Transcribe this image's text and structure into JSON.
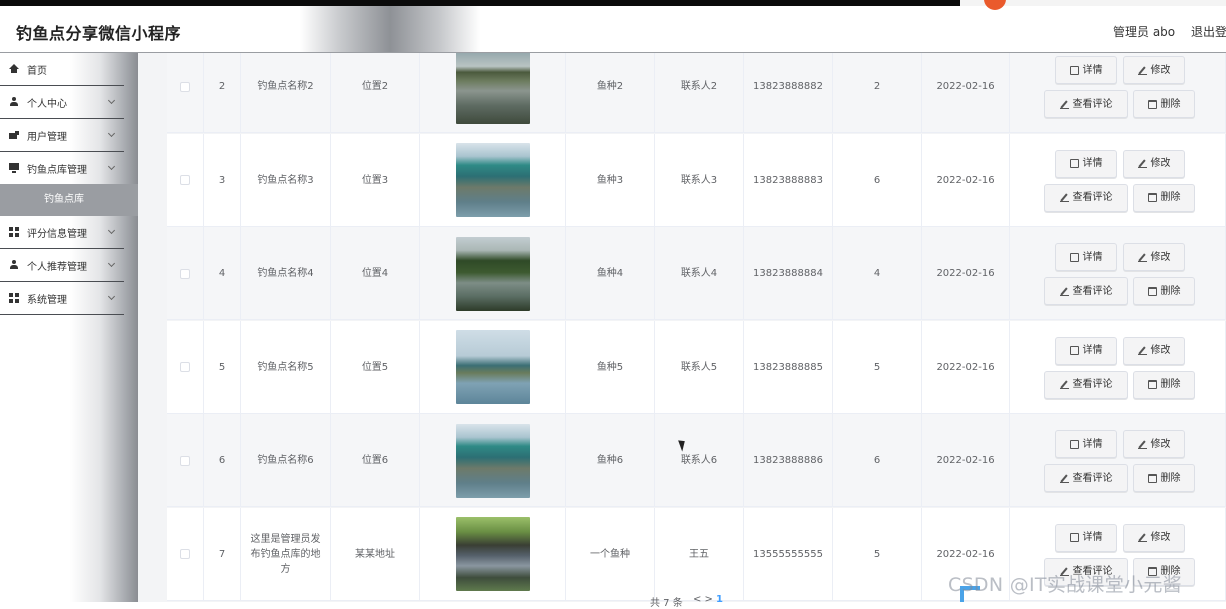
{
  "header": {
    "app_title": "钓鱼点分享微信小程序",
    "admin_label": "管理员 abo",
    "logout_label": "退出登"
  },
  "sidebar": {
    "items": [
      {
        "label": "首页",
        "icon": "home-icon"
      },
      {
        "label": "个人中心",
        "icon": "user-icon"
      },
      {
        "label": "用户管理",
        "icon": "users-icon"
      },
      {
        "label": "钓鱼点库管理",
        "icon": "monitor-icon"
      },
      {
        "label": "评分信息管理",
        "icon": "grid-icon"
      },
      {
        "label": "个人推荐管理",
        "icon": "user-icon"
      },
      {
        "label": "系统管理",
        "icon": "grid-icon"
      }
    ],
    "submenu_active": "钓鱼点库"
  },
  "table": {
    "rows": [
      {
        "index": "2",
        "name": "钓鱼点名称2",
        "location": "位置2",
        "fish": "鱼种2",
        "contact": "联系人2",
        "phone": "13823888882",
        "score": "2",
        "date": "2022-02-16",
        "image": "lake-calm"
      },
      {
        "index": "3",
        "name": "钓鱼点名称3",
        "location": "位置3",
        "fish": "鱼种3",
        "contact": "联系人3",
        "phone": "13823888883",
        "score": "6",
        "date": "2022-02-16",
        "image": "anglers-umbrellas"
      },
      {
        "index": "4",
        "name": "钓鱼点名称4",
        "location": "位置4",
        "fish": "鱼种4",
        "contact": "联系人4",
        "phone": "13823888884",
        "score": "4",
        "date": "2022-02-16",
        "image": "lake-hills"
      },
      {
        "index": "5",
        "name": "钓鱼点名称5",
        "location": "位置5",
        "fish": "鱼种5",
        "contact": "联系人5",
        "phone": "13823888885",
        "score": "5",
        "date": "2022-02-16",
        "image": "anglers-bank"
      },
      {
        "index": "6",
        "name": "钓鱼点名称6",
        "location": "位置6",
        "fish": "鱼种6",
        "contact": "联系人6",
        "phone": "13823888886",
        "score": "6",
        "date": "2022-02-16",
        "image": "anglers-umbrellas"
      },
      {
        "index": "7",
        "name": "这里是管理员发布钓鱼点库的地方",
        "location": "某某地址",
        "fish": "一个鱼种",
        "contact": "王五",
        "phone": "13555555555",
        "score": "5",
        "date": "2022-02-16",
        "image": "village-canal"
      }
    ],
    "actions": {
      "detail": "详情",
      "edit": "修改",
      "view_comments": "查看评论",
      "delete": "删除"
    }
  },
  "pagination": {
    "total_text": "共 7 条",
    "current_page": "1",
    "arrows": "<         >"
  },
  "watermark": "CSDN @IT实战课堂小元酱",
  "colors": {
    "accent": "#409eff",
    "brand_orange": "#e8572a",
    "sidebar_active": "#9a9da2"
  }
}
